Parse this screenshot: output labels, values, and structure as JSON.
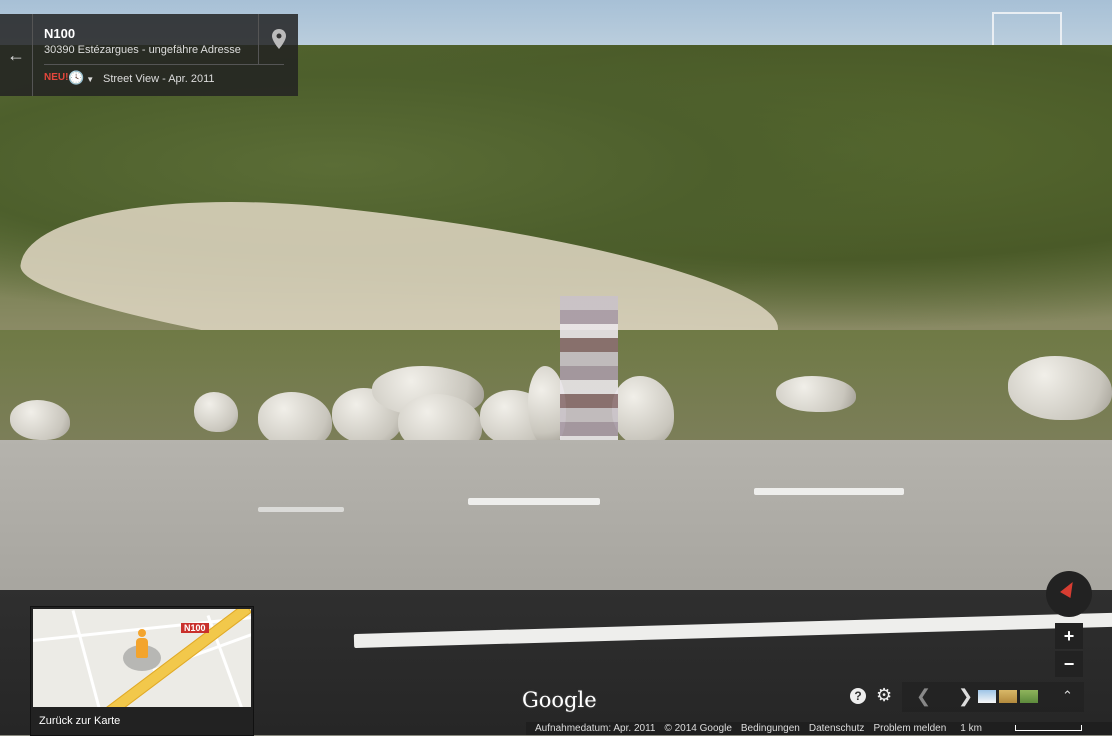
{
  "info_card": {
    "title": "N100",
    "address": "30390 Estézargues - ungefähre Adresse",
    "new_badge": "NEU!",
    "streetview_date": "Street View - Apr. 2011",
    "icons": {
      "back": "arrow-left-icon",
      "pin": "map-pin-icon",
      "history": "clock-icon"
    }
  },
  "minimap": {
    "road_label": "N100",
    "back_label": "Zurück zur Karte"
  },
  "brand": "Google",
  "controls": {
    "zoom_in": "+",
    "zoom_out": "−",
    "help": "?"
  },
  "footer": {
    "capture_date": "Aufnahmedatum: Apr. 2011",
    "copyright": "© 2014 Google",
    "terms": "Bedingungen",
    "privacy": "Datenschutz",
    "report": "Problem melden",
    "scale": "1 km"
  },
  "colors": {
    "badge": "#e4473c",
    "compass_red": "#d73d32",
    "road_yellow": "#f2c84b"
  }
}
